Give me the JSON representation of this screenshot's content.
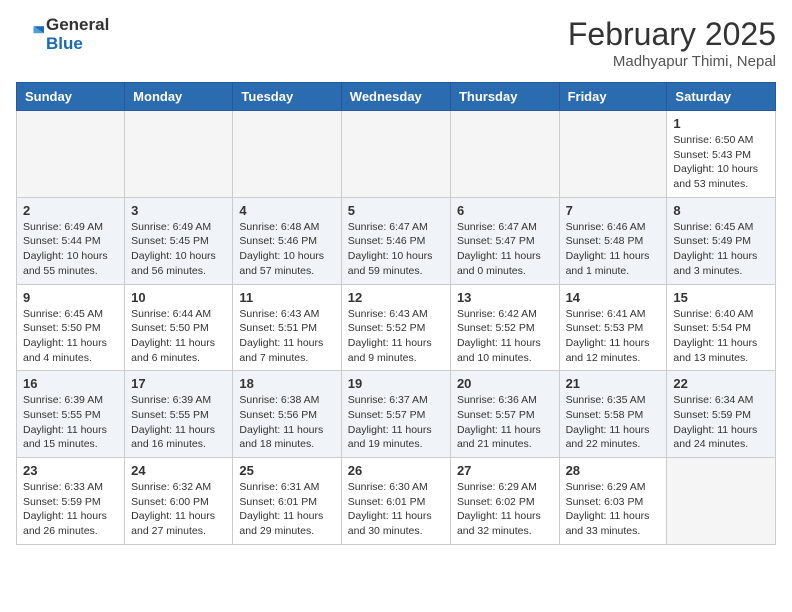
{
  "header": {
    "logo_general": "General",
    "logo_blue": "Blue",
    "month": "February 2025",
    "location": "Madhyapur Thimi, Nepal"
  },
  "days_of_week": [
    "Sunday",
    "Monday",
    "Tuesday",
    "Wednesday",
    "Thursday",
    "Friday",
    "Saturday"
  ],
  "weeks": [
    {
      "alt": false,
      "days": [
        {
          "num": "",
          "info": ""
        },
        {
          "num": "",
          "info": ""
        },
        {
          "num": "",
          "info": ""
        },
        {
          "num": "",
          "info": ""
        },
        {
          "num": "",
          "info": ""
        },
        {
          "num": "",
          "info": ""
        },
        {
          "num": "1",
          "info": "Sunrise: 6:50 AM\nSunset: 5:43 PM\nDaylight: 10 hours and 53 minutes."
        }
      ]
    },
    {
      "alt": true,
      "days": [
        {
          "num": "2",
          "info": "Sunrise: 6:49 AM\nSunset: 5:44 PM\nDaylight: 10 hours and 55 minutes."
        },
        {
          "num": "3",
          "info": "Sunrise: 6:49 AM\nSunset: 5:45 PM\nDaylight: 10 hours and 56 minutes."
        },
        {
          "num": "4",
          "info": "Sunrise: 6:48 AM\nSunset: 5:46 PM\nDaylight: 10 hours and 57 minutes."
        },
        {
          "num": "5",
          "info": "Sunrise: 6:47 AM\nSunset: 5:46 PM\nDaylight: 10 hours and 59 minutes."
        },
        {
          "num": "6",
          "info": "Sunrise: 6:47 AM\nSunset: 5:47 PM\nDaylight: 11 hours and 0 minutes."
        },
        {
          "num": "7",
          "info": "Sunrise: 6:46 AM\nSunset: 5:48 PM\nDaylight: 11 hours and 1 minute."
        },
        {
          "num": "8",
          "info": "Sunrise: 6:45 AM\nSunset: 5:49 PM\nDaylight: 11 hours and 3 minutes."
        }
      ]
    },
    {
      "alt": false,
      "days": [
        {
          "num": "9",
          "info": "Sunrise: 6:45 AM\nSunset: 5:50 PM\nDaylight: 11 hours and 4 minutes."
        },
        {
          "num": "10",
          "info": "Sunrise: 6:44 AM\nSunset: 5:50 PM\nDaylight: 11 hours and 6 minutes."
        },
        {
          "num": "11",
          "info": "Sunrise: 6:43 AM\nSunset: 5:51 PM\nDaylight: 11 hours and 7 minutes."
        },
        {
          "num": "12",
          "info": "Sunrise: 6:43 AM\nSunset: 5:52 PM\nDaylight: 11 hours and 9 minutes."
        },
        {
          "num": "13",
          "info": "Sunrise: 6:42 AM\nSunset: 5:52 PM\nDaylight: 11 hours and 10 minutes."
        },
        {
          "num": "14",
          "info": "Sunrise: 6:41 AM\nSunset: 5:53 PM\nDaylight: 11 hours and 12 minutes."
        },
        {
          "num": "15",
          "info": "Sunrise: 6:40 AM\nSunset: 5:54 PM\nDaylight: 11 hours and 13 minutes."
        }
      ]
    },
    {
      "alt": true,
      "days": [
        {
          "num": "16",
          "info": "Sunrise: 6:39 AM\nSunset: 5:55 PM\nDaylight: 11 hours and 15 minutes."
        },
        {
          "num": "17",
          "info": "Sunrise: 6:39 AM\nSunset: 5:55 PM\nDaylight: 11 hours and 16 minutes."
        },
        {
          "num": "18",
          "info": "Sunrise: 6:38 AM\nSunset: 5:56 PM\nDaylight: 11 hours and 18 minutes."
        },
        {
          "num": "19",
          "info": "Sunrise: 6:37 AM\nSunset: 5:57 PM\nDaylight: 11 hours and 19 minutes."
        },
        {
          "num": "20",
          "info": "Sunrise: 6:36 AM\nSunset: 5:57 PM\nDaylight: 11 hours and 21 minutes."
        },
        {
          "num": "21",
          "info": "Sunrise: 6:35 AM\nSunset: 5:58 PM\nDaylight: 11 hours and 22 minutes."
        },
        {
          "num": "22",
          "info": "Sunrise: 6:34 AM\nSunset: 5:59 PM\nDaylight: 11 hours and 24 minutes."
        }
      ]
    },
    {
      "alt": false,
      "days": [
        {
          "num": "23",
          "info": "Sunrise: 6:33 AM\nSunset: 5:59 PM\nDaylight: 11 hours and 26 minutes."
        },
        {
          "num": "24",
          "info": "Sunrise: 6:32 AM\nSunset: 6:00 PM\nDaylight: 11 hours and 27 minutes."
        },
        {
          "num": "25",
          "info": "Sunrise: 6:31 AM\nSunset: 6:01 PM\nDaylight: 11 hours and 29 minutes."
        },
        {
          "num": "26",
          "info": "Sunrise: 6:30 AM\nSunset: 6:01 PM\nDaylight: 11 hours and 30 minutes."
        },
        {
          "num": "27",
          "info": "Sunrise: 6:29 AM\nSunset: 6:02 PM\nDaylight: 11 hours and 32 minutes."
        },
        {
          "num": "28",
          "info": "Sunrise: 6:29 AM\nSunset: 6:03 PM\nDaylight: 11 hours and 33 minutes."
        },
        {
          "num": "",
          "info": ""
        }
      ]
    }
  ]
}
